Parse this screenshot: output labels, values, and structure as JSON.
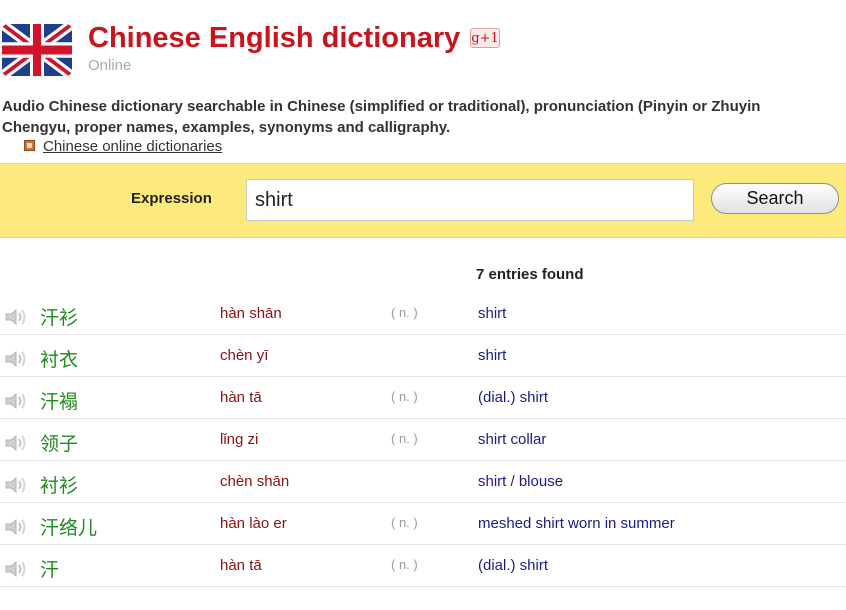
{
  "header": {
    "title": "Chinese English dictionary",
    "gplus_label": "g+1",
    "subtitle": "Online",
    "description_line1": "Audio Chinese dictionary searchable in Chinese (simplified or traditional), pronunciation (Pinyin or Zhuyin",
    "description_line2": "Chengyu, proper names, examples, synonyms and calligraphy.",
    "link_label": "Chinese online dictionaries"
  },
  "search": {
    "label": "Expression",
    "value": "shirt",
    "button_label": "Search"
  },
  "results": {
    "count_label": "7 entries found",
    "entries": [
      {
        "hanzi": "汗衫",
        "pinyin": "hàn shān",
        "pos": "( n. )",
        "meaning": "shirt"
      },
      {
        "hanzi": "衬衣",
        "pinyin": "chèn yī",
        "pos": "",
        "meaning": "shirt"
      },
      {
        "hanzi": "汗褟",
        "pinyin": "hàn tā",
        "pos": "( n. )",
        "meaning": "(dial.) shirt"
      },
      {
        "hanzi": "领子",
        "pinyin": "lǐng zi",
        "pos": "( n. )",
        "meaning": "shirt collar"
      },
      {
        "hanzi": "衬衫",
        "pinyin": "chèn shān",
        "pos": "",
        "meaning": "shirt / blouse"
      },
      {
        "hanzi": "汗络儿",
        "pinyin": "hàn lào er",
        "pos": "( n. )",
        "meaning": "meshed shirt worn in summer"
      },
      {
        "hanzi": "汗",
        "pinyin": "hàn tā",
        "pos": "( n. )",
        "meaning": "(dial.) shirt"
      }
    ]
  },
  "colors": {
    "title": "#c8141e",
    "search_band": "#fdea7d",
    "hanzi": "#1e8a1e",
    "pinyin": "#8b1010",
    "meaning": "#1a1a8c"
  },
  "icons": {
    "flag": "uk-flag-icon",
    "speaker": "audio-speaker-icon",
    "bullet": "bullet-square-icon"
  }
}
